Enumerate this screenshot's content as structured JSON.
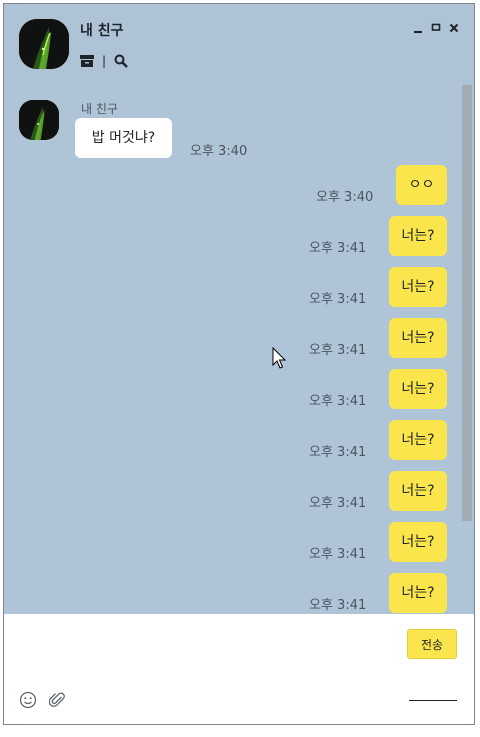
{
  "header": {
    "chat_name": "내 친구",
    "tools": [
      {
        "icon": "archive-icon"
      },
      {
        "separator": "|"
      },
      {
        "icon": "search-icon"
      }
    ],
    "window_controls": [
      "minimize-icon",
      "maximize-icon",
      "close-icon"
    ]
  },
  "messages": [
    {
      "direction": "incoming",
      "sender": "내 친구",
      "text": "밥 머것냐?",
      "time": "오후 3:40"
    },
    {
      "direction": "outgoing",
      "text": "ㅇㅇ",
      "time": "오후 3:40"
    },
    {
      "direction": "outgoing",
      "text": "너는?",
      "time": "오후 3:41"
    },
    {
      "direction": "outgoing",
      "text": "너는?",
      "time": "오후 3:41"
    },
    {
      "direction": "outgoing",
      "text": "너는?",
      "time": "오후 3:41"
    },
    {
      "direction": "outgoing",
      "text": "너는?",
      "time": "오후 3:41"
    },
    {
      "direction": "outgoing",
      "text": "너는?",
      "time": "오후 3:41"
    },
    {
      "direction": "outgoing",
      "text": "너는?",
      "time": "오후 3:41"
    },
    {
      "direction": "outgoing",
      "text": "너는?",
      "time": "오후 3:41"
    },
    {
      "direction": "outgoing",
      "text": "너는?",
      "time": "오후 3:41"
    }
  ],
  "input": {
    "value": "",
    "send_label": "전송",
    "icons": [
      "emoji-icon",
      "attachment-icon"
    ]
  },
  "colors": {
    "chat_background": "#afc4d6",
    "outgoing_bubble": "#fae64c",
    "incoming_bubble": "#ffffff"
  }
}
